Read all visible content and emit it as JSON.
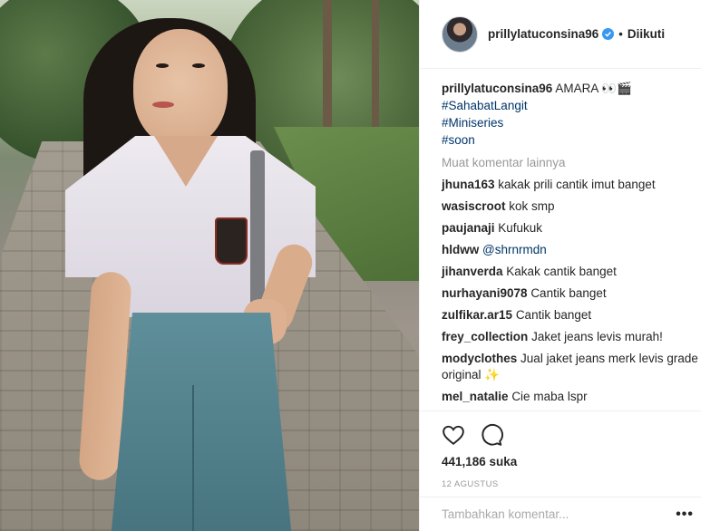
{
  "post": {
    "username": "prillylatuconsina96",
    "follow_status": "Diikuti",
    "separator": "•",
    "caption": {
      "text": "AMARA 👀🎬",
      "hashtags": [
        "#SahabatLangit",
        "#Miniseries",
        "#soon"
      ]
    },
    "load_more": "Muat komentar lainnya",
    "comments": [
      {
        "user": "jhuna163",
        "text": "kakak prili cantik imut banget"
      },
      {
        "user": "wasiscroot",
        "text": "kok smp"
      },
      {
        "user": "paujanaji",
        "text": "Kufukuk"
      },
      {
        "user": "hldww",
        "text": "@shrnrmdn"
      },
      {
        "user": "jihanverda",
        "text": "Kakak cantik banget"
      },
      {
        "user": "nurhayani9078",
        "text": "Cantik banget"
      },
      {
        "user": "zulfikar.ar15",
        "text": "Cantik banget"
      },
      {
        "user": "frey_collection",
        "text": "Jaket jeans levis murah!"
      },
      {
        "user": "modyclothes",
        "text": "Jual jaket jeans merk levis grade original ✨"
      },
      {
        "user": "mel_natalie",
        "text": "Cie maba lspr"
      }
    ],
    "likes": "441,186 suka",
    "date": "12 AGUSTUS",
    "add_comment_placeholder": "Tambahkan komentar...",
    "more_label": "•••"
  },
  "icons": {
    "like": "heart-icon",
    "comment": "comment-bubble-icon",
    "verified": "verified-badge-icon"
  },
  "colors": {
    "link": "#003569",
    "verified": "#3897f0",
    "muted": "#999999"
  }
}
